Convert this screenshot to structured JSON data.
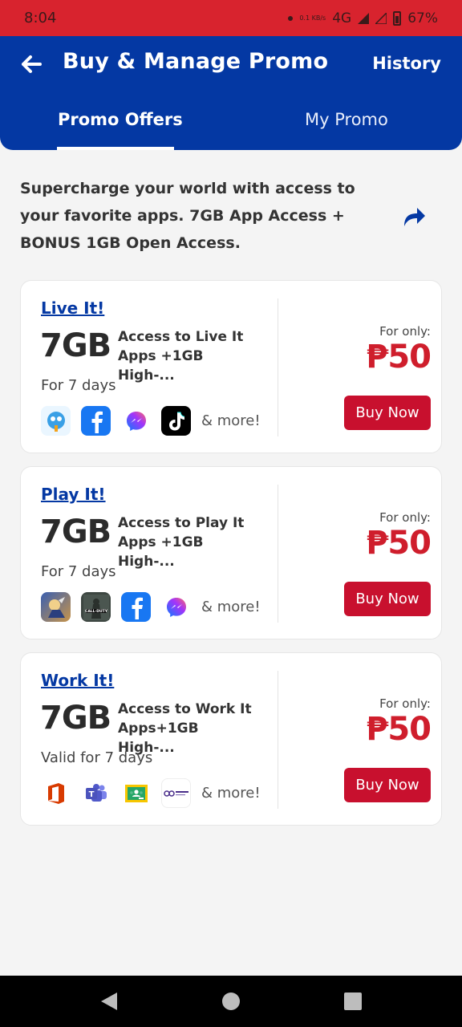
{
  "status": {
    "time": "8:04",
    "net_speed": "0.1 KB/s",
    "network": "4G",
    "battery": "67%"
  },
  "header": {
    "title": "Buy & Manage Promo",
    "history_label": "History"
  },
  "tabs": [
    {
      "label": "Promo Offers",
      "active": true
    },
    {
      "label": "My Promo",
      "active": false
    }
  ],
  "intro": "Supercharge your world with access to your favorite apps. 7GB App Access + BONUS 1GB Open Access.",
  "offers": [
    {
      "name": "Live It!",
      "data": "7GB",
      "description": "Access to Live It Apps +1GB High-...",
      "validity": "For 7 days",
      "apps": [
        "ugo-icon",
        "facebook-icon",
        "messenger-icon",
        "tiktok-icon"
      ],
      "more": "& more!",
      "price_label": "For only:",
      "price": "₱50",
      "buy_label": "Buy Now"
    },
    {
      "name": "Play It!",
      "data": "7GB",
      "description": "Access to Play It Apps +1GB High-...",
      "validity": "For 7 days",
      "apps": [
        "mobile-legends-icon",
        "call-of-duty-icon",
        "facebook-icon",
        "messenger-icon"
      ],
      "more": "& more!",
      "price_label": "For only:",
      "price": "₱50",
      "buy_label": "Buy Now"
    },
    {
      "name": "Work It!",
      "data": "7GB",
      "description": "Access to Work It Apps+1GB High-...",
      "validity": "Valid for 7 days",
      "apps": [
        "office-icon",
        "teams-icon",
        "google-classroom-icon",
        "luna-icon"
      ],
      "more": "& more!",
      "price_label": "For only:",
      "price": "₱50",
      "buy_label": "Buy Now"
    }
  ],
  "colors": {
    "brand_blue": "#0438a3",
    "accent_red": "#c8102e",
    "status_red": "#d8232e"
  }
}
